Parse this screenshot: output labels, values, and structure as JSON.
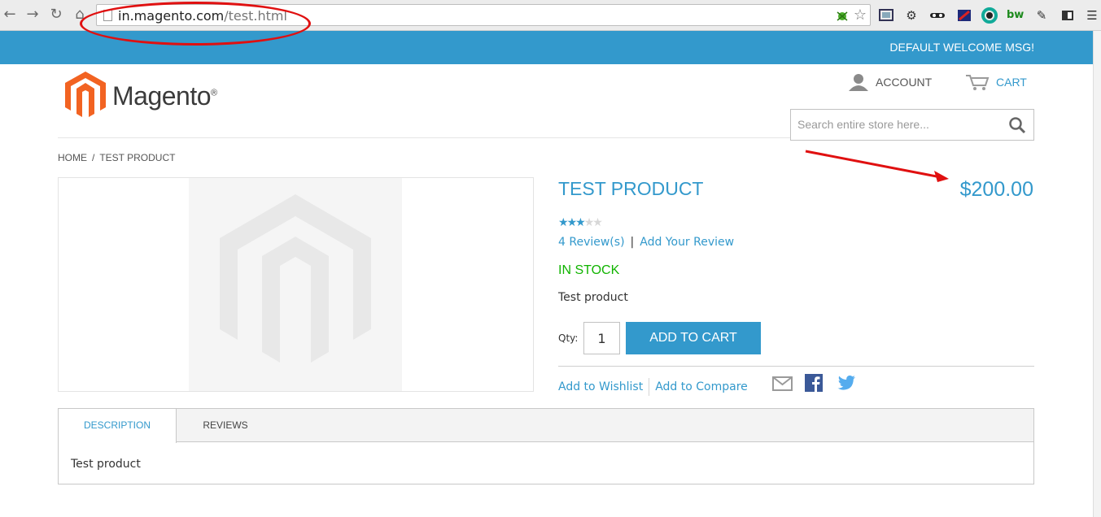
{
  "browser": {
    "url_host": "in.magento.com",
    "url_path": "/test.html",
    "icons": [
      "back-icon",
      "forward-icon",
      "reload-icon",
      "home-icon",
      "bug-extension-icon",
      "bookmark-star-icon",
      "screen-capture-icon",
      "settings-gear-icon",
      "mask-extension-icon",
      "flag-extension-icon",
      "color-wheel-icon",
      "bw-extension-icon",
      "edit-extension-icon",
      "sidebar-extension-icon",
      "menu-icon"
    ],
    "bw_label": "bw"
  },
  "store": {
    "welcome_message": "DEFAULT WELCOME MSG!",
    "logo_text": "Magento",
    "logo_mark": "®",
    "account_label": "ACCOUNT",
    "cart_label": "CART",
    "search_placeholder": "Search entire store here..."
  },
  "breadcrumb": {
    "home": "HOME",
    "separator": "/",
    "current": "TEST PRODUCT"
  },
  "product": {
    "name": "TEST PRODUCT",
    "price": "$200.00",
    "rating_stars": 3,
    "rating_max": 5,
    "reviews_link": "4 Review(s)",
    "review_separator": "|",
    "add_review_link": "Add Your Review",
    "stock_status": "IN STOCK",
    "short_description": "Test product",
    "qty_label": "Qty:",
    "qty_value": "1",
    "add_to_cart_label": "ADD TO CART",
    "wishlist_link": "Add to Wishlist",
    "compare_link": "Add to Compare"
  },
  "tabs": {
    "items": [
      {
        "label": "DESCRIPTION",
        "active": true
      },
      {
        "label": "REVIEWS",
        "active": false
      }
    ],
    "content": "Test product"
  },
  "colors": {
    "brand_blue": "#3399cc",
    "stock_green": "#11b400",
    "annotation_red": "#e01010",
    "logo_orange": "#f26322"
  }
}
